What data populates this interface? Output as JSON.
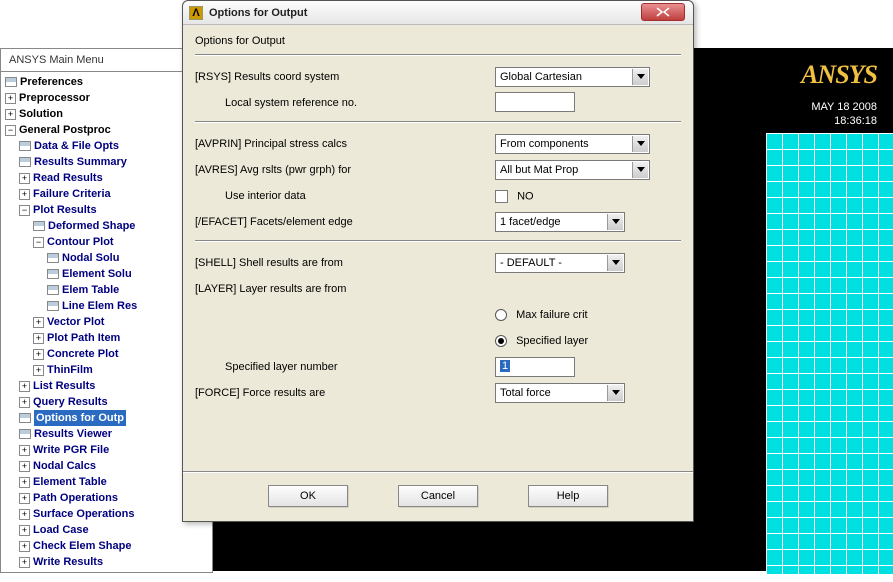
{
  "main_menu": {
    "title": "ANSYS Main Menu",
    "items": [
      {
        "label": "Preferences",
        "type": "leaf",
        "bold": true,
        "indent": 0,
        "icon": "leaf"
      },
      {
        "label": "Preprocessor",
        "type": "plus",
        "bold": true,
        "indent": 0
      },
      {
        "label": "Solution",
        "type": "plus",
        "bold": true,
        "indent": 0
      },
      {
        "label": "General Postproc",
        "type": "minus",
        "bold": true,
        "indent": 0
      },
      {
        "label": "Data & File Opts",
        "type": "leaf",
        "indent": 1,
        "icon": "leaf",
        "boldblue": true
      },
      {
        "label": "Results Summary",
        "type": "leaf",
        "indent": 1,
        "icon": "leaf",
        "boldblue": true
      },
      {
        "label": "Read Results",
        "type": "plus",
        "indent": 1,
        "boldblue": true
      },
      {
        "label": "Failure Criteria",
        "type": "plus",
        "indent": 1,
        "boldblue": true
      },
      {
        "label": "Plot Results",
        "type": "minus",
        "indent": 1,
        "boldblue": true
      },
      {
        "label": "Deformed Shape",
        "type": "leaf",
        "indent": 2,
        "icon": "leaf",
        "boldblue": true
      },
      {
        "label": "Contour Plot",
        "type": "minus",
        "indent": 2,
        "boldblue": true
      },
      {
        "label": "Nodal Solu",
        "type": "leaf",
        "indent": 3,
        "icon": "leaf",
        "boldblue": true
      },
      {
        "label": "Element Solu",
        "type": "leaf",
        "indent": 3,
        "icon": "leaf",
        "boldblue": true
      },
      {
        "label": "Elem Table",
        "type": "leaf",
        "indent": 3,
        "icon": "leaf",
        "boldblue": true
      },
      {
        "label": "Line Elem Res",
        "type": "leaf",
        "indent": 3,
        "icon": "leaf",
        "boldblue": true
      },
      {
        "label": "Vector Plot",
        "type": "plus",
        "indent": 2,
        "boldblue": true
      },
      {
        "label": "Plot Path Item",
        "type": "plus",
        "indent": 2,
        "boldblue": true
      },
      {
        "label": "Concrete Plot",
        "type": "plus",
        "indent": 2,
        "boldblue": true
      },
      {
        "label": "ThinFilm",
        "type": "plus",
        "indent": 2,
        "boldblue": true
      },
      {
        "label": "List Results",
        "type": "plus",
        "indent": 1,
        "boldblue": true
      },
      {
        "label": "Query Results",
        "type": "plus",
        "indent": 1,
        "boldblue": true
      },
      {
        "label": "Options for Outp",
        "type": "leaf",
        "indent": 1,
        "icon": "leaf",
        "selected": true,
        "boldblue": true
      },
      {
        "label": "Results Viewer",
        "type": "leaf",
        "indent": 1,
        "icon": "leaf",
        "boldblue": true
      },
      {
        "label": "Write PGR File",
        "type": "plus",
        "indent": 1,
        "boldblue": true
      },
      {
        "label": "Nodal Calcs",
        "type": "plus",
        "indent": 1,
        "boldblue": true
      },
      {
        "label": "Element Table",
        "type": "plus",
        "indent": 1,
        "boldblue": true
      },
      {
        "label": "Path Operations",
        "type": "plus",
        "indent": 1,
        "boldblue": true
      },
      {
        "label": "Surface Operations",
        "type": "plus",
        "indent": 1,
        "boldblue": true
      },
      {
        "label": "Load Case",
        "type": "plus",
        "indent": 1,
        "boldblue": true
      },
      {
        "label": "Check Elem Shape",
        "type": "plus",
        "indent": 1,
        "boldblue": true
      },
      {
        "label": "Write Results",
        "type": "plus",
        "indent": 1,
        "boldblue": true
      }
    ]
  },
  "right": {
    "logo": "ANSYS",
    "date": "MAY 18 2008",
    "time": "18:36:18"
  },
  "dialog": {
    "title": "Options for Output",
    "subtitle": "Options for Output",
    "s1": {
      "rsys_label": "[RSYS]   Results coord system",
      "rsys_value": "Global Cartesian",
      "localref_label": "Local system reference no.",
      "localref_value": ""
    },
    "s2": {
      "avprn_label": "[AVPRIN]  Principal stress calcs",
      "avprn_value": "From components",
      "avres_label": "[AVRES]  Avg rslts (pwr grph) for",
      "avres_value": "All but Mat Prop",
      "interior_label": "Use interior data",
      "interior_value": "NO",
      "efacet_label": "[/EFACET]  Facets/element edge",
      "efacet_value": "1 facet/edge"
    },
    "s3": {
      "shell_label": "[SHELL]   Shell results are from",
      "shell_value": "- DEFAULT -",
      "layer_label": "[LAYER]   Layer results are from",
      "radio1": "Max failure crit",
      "radio2": "Specified layer",
      "speclayer_label": "Specified layer number",
      "speclayer_value": "1",
      "force_label": "[FORCE]  Force results are",
      "force_value": "Total force"
    },
    "buttons": {
      "ok": "OK",
      "cancel": "Cancel",
      "help": "Help"
    }
  }
}
